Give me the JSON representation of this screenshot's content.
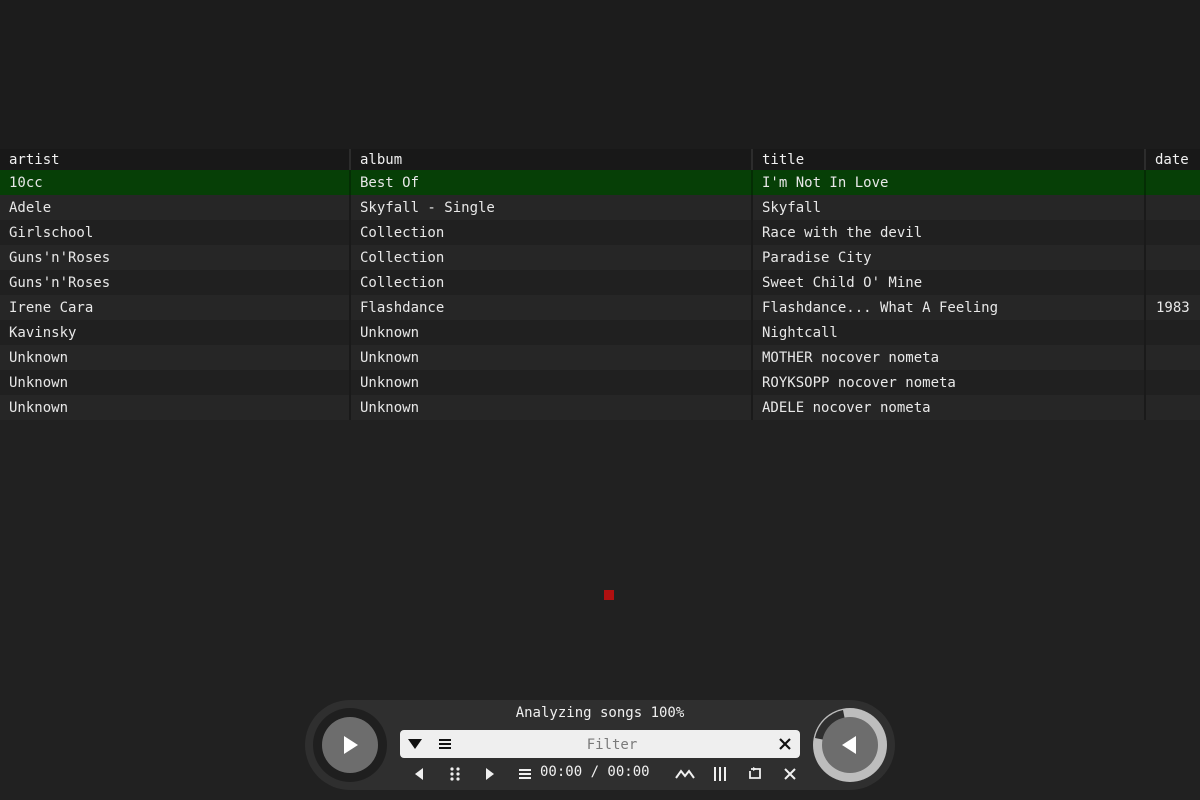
{
  "table": {
    "headers": [
      "artist",
      "album",
      "title",
      "date"
    ],
    "rows": [
      {
        "artist": "10cc",
        "album": "Best Of",
        "title": "I'm Not In Love",
        "date": "",
        "selected": true
      },
      {
        "artist": "Adele",
        "album": "Skyfall - Single",
        "title": "Skyfall",
        "date": ""
      },
      {
        "artist": "Girlschool",
        "album": "Collection",
        "title": "Race with the devil",
        "date": ""
      },
      {
        "artist": "Guns'n'Roses",
        "album": "Collection",
        "title": "Paradise City",
        "date": ""
      },
      {
        "artist": "Guns'n'Roses",
        "album": "Collection",
        "title": "Sweet Child O' Mine",
        "date": ""
      },
      {
        "artist": "Irene Cara",
        "album": "Flashdance",
        "title": "Flashdance... What A Feeling",
        "date": "1983"
      },
      {
        "artist": "Kavinsky",
        "album": "Unknown",
        "title": "Nightcall",
        "date": ""
      },
      {
        "artist": "Unknown",
        "album": "Unknown",
        "title": "MOTHER nocover nometa",
        "date": ""
      },
      {
        "artist": "Unknown",
        "album": "Unknown",
        "title": "ROYKSOPP nocover nometa",
        "date": ""
      },
      {
        "artist": "Unknown",
        "album": "Unknown",
        "title": "ADELE nocover nometa",
        "date": ""
      }
    ]
  },
  "player": {
    "status": "Analyzing songs 100%",
    "filter_placeholder": "Filter",
    "time": "00:00 / 00:00",
    "icons": {
      "play_button": "play-icon",
      "prev_button": "previous-icon",
      "filter_dropdown": "dropdown-icon",
      "filter_menu": "menu-icon",
      "filter_clear": "close-icon",
      "controls": [
        "prev-small-icon",
        "grip-icon",
        "next-small-icon",
        "list-icon",
        "chevron-up-icon",
        "columns-icon",
        "repeat-icon",
        "close-icon"
      ]
    }
  },
  "colors": {
    "background": "#212121",
    "selected_row": "#063f06",
    "header": "#181818",
    "filter_bg": "#efefef",
    "indicator": "#b01010"
  }
}
